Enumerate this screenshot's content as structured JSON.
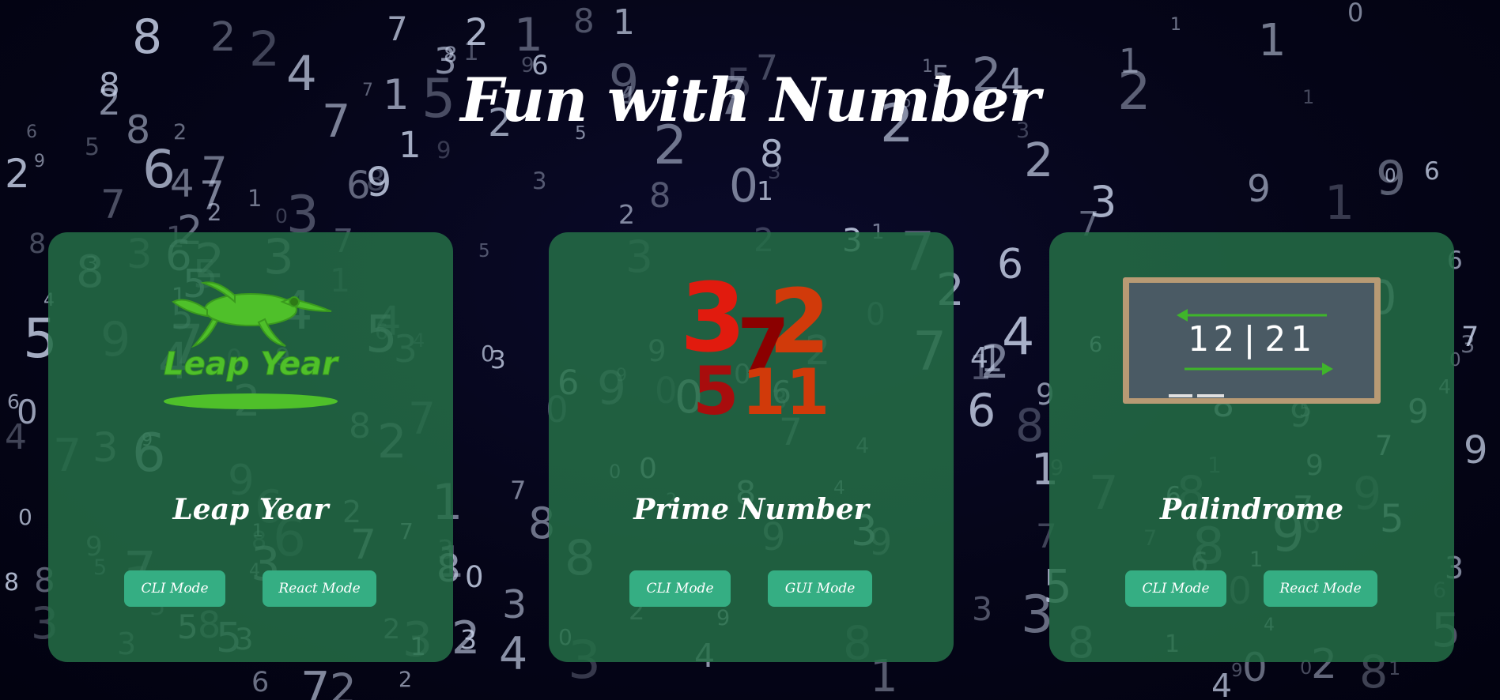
{
  "page": {
    "title": "Fun with Number"
  },
  "cards": [
    {
      "title": "Leap Year",
      "image_label": "Leap Year",
      "icon": "frog-icon",
      "buttons": [
        "CLI Mode",
        "React Mode"
      ]
    },
    {
      "title": "Prime Number",
      "image_numbers": [
        "3",
        "7",
        "2",
        "5",
        "11"
      ],
      "icon": "prime-numbers-icon",
      "buttons": [
        "CLI Mode",
        "GUI Mode"
      ]
    },
    {
      "title": "Palindrome",
      "image_label": "12|21",
      "icon": "chalkboard-icon",
      "buttons": [
        "CLI Mode",
        "React Mode"
      ]
    }
  ],
  "colors": {
    "background": "#050518",
    "card": "#246e46",
    "button": "#35ae83",
    "text": "#ffffff",
    "frog_green": "#4fc02a",
    "prime_red": "#e11b0e",
    "prime_darkred": "#8b0000",
    "prime_orange": "#d13a0a",
    "chalkboard": "#4a5a64",
    "chalkboard_frame": "#b89a74"
  }
}
